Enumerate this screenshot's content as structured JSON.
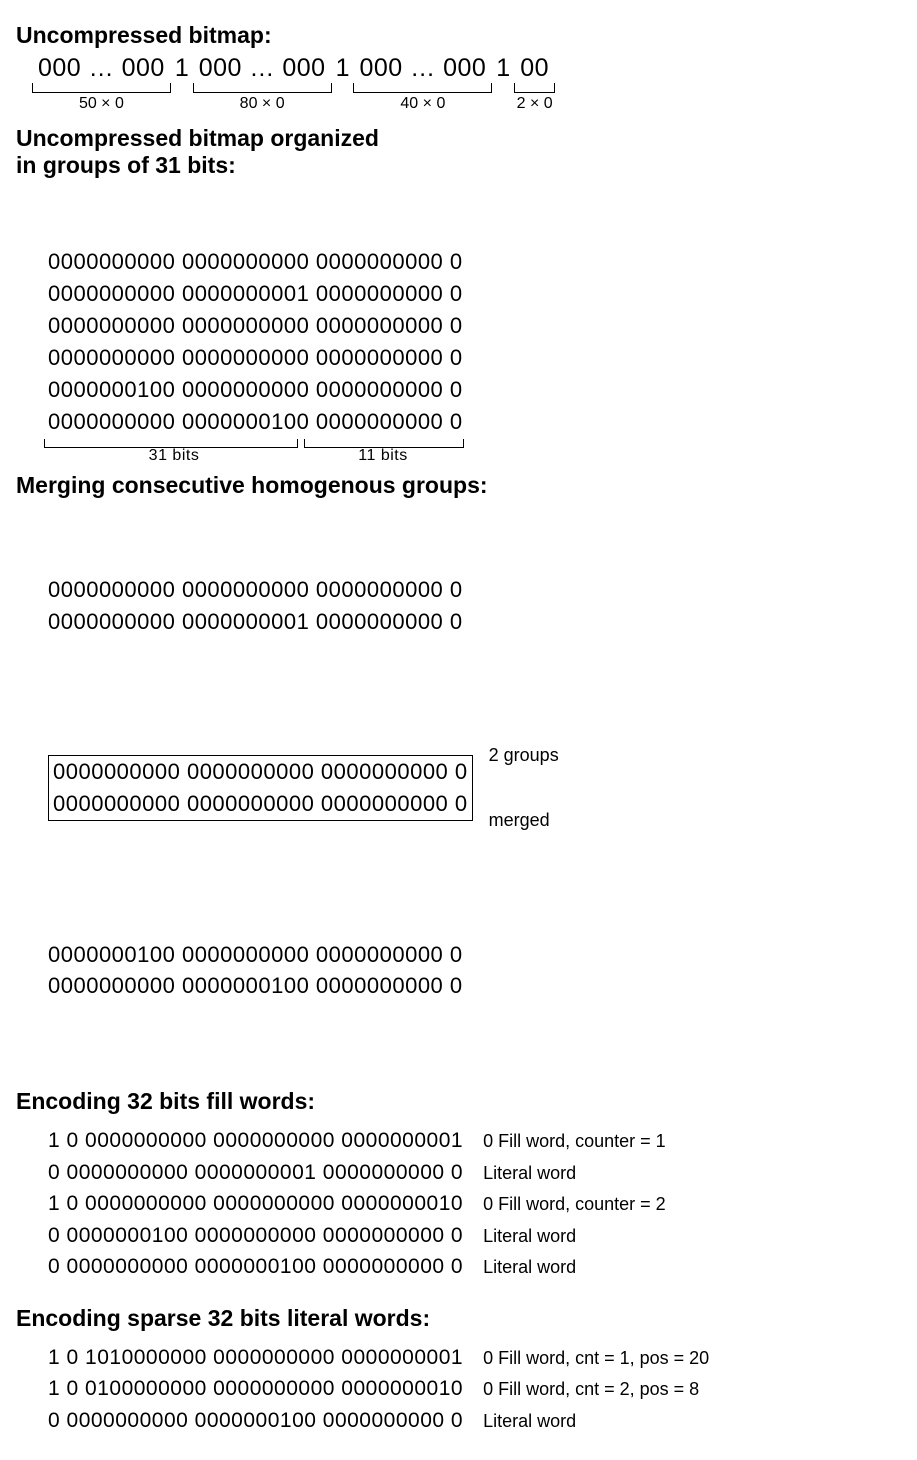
{
  "section1": {
    "title": "Uncompressed bitmap:",
    "segments": [
      {
        "text": "000 … 000",
        "label": "50 × 0"
      },
      {
        "sep": "1"
      },
      {
        "text": "000 … 000",
        "label": "80 × 0"
      },
      {
        "sep": "1"
      },
      {
        "text": "000 … 000",
        "label": "40 × 0"
      },
      {
        "sep": "1"
      },
      {
        "text": "00",
        "label": "2 × 0"
      }
    ]
  },
  "section2": {
    "title_l1": "Uncompressed bitmap organized",
    "title_l2": "in groups of 31 bits:",
    "rows": [
      "0000000000 0000000000 0000000000 0",
      "0000000000 0000000001 0000000000 0",
      "0000000000 0000000000 0000000000 0",
      "0000000000 0000000000 0000000000 0",
      "0000000100 0000000000 0000000000 0",
      "0000000000 0000000100 0000000000 0"
    ],
    "brace31": "31 bits",
    "brace11": "11 bits"
  },
  "section3": {
    "title": "Merging consecutive homogenous groups:",
    "rows_pre": [
      "0000000000 0000000000 0000000000 0",
      "0000000000 0000000001 0000000000 0"
    ],
    "rows_merged": [
      "0000000000 0000000000 0000000000 0",
      "0000000000 0000000000 0000000000 0"
    ],
    "merge_note_l1": "2 groups",
    "merge_note_l2": "merged",
    "rows_post": [
      "0000000100 0000000000 0000000000 0",
      "0000000000 0000000100 0000000000 0"
    ]
  },
  "section4": {
    "title": "Encoding 32 bits fill words:",
    "rows": [
      {
        "bits": "1 0 0000000000 0000000000 0000000001",
        "label": "0 Fill word, counter = 1"
      },
      {
        "bits": "0 0000000000 0000000001 0000000000 0",
        "label": "Literal word"
      },
      {
        "bits": "1 0 0000000000 0000000000 0000000010",
        "label": "0 Fill word, counter = 2"
      },
      {
        "bits": "0 0000000100 0000000000 0000000000 0",
        "label": "Literal word"
      },
      {
        "bits": "0 0000000000 0000000100 0000000000 0",
        "label": "Literal word"
      }
    ]
  },
  "section5": {
    "title": "Encoding sparse 32 bits literal words:",
    "rows": [
      {
        "bits": "1 0 1010000000 0000000000 0000000001",
        "label": "0 Fill word, cnt = 1, pos = 20"
      },
      {
        "bits": "1 0 0100000000 0000000000 0000000010",
        "label": "0 Fill word, cnt = 2, pos = 8"
      },
      {
        "bits": "0 0000000000 0000000100 0000000000 0",
        "label": "Literal word"
      }
    ]
  }
}
